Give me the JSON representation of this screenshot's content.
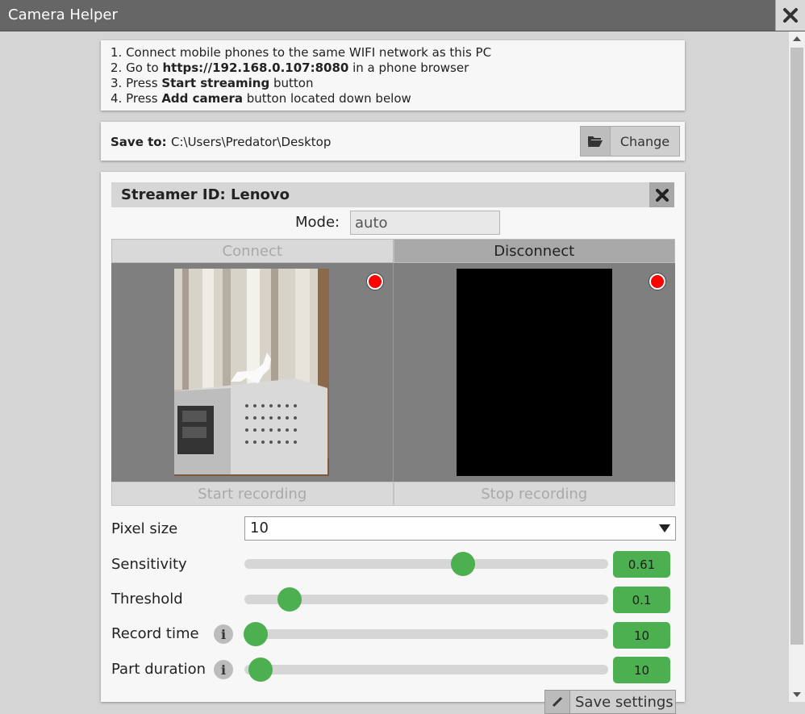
{
  "app": {
    "title": "Camera Helper"
  },
  "instructions": {
    "lines": [
      {
        "prefix": "1. Connect mobile phones to the same WIFI network as this PC",
        "bold": "",
        "suffix": ""
      },
      {
        "prefix": "2. Go to ",
        "bold": "https://192.168.0.107:8080",
        "suffix": " in a phone browser"
      },
      {
        "prefix": "3. Press ",
        "bold": "Start streaming",
        "suffix": " button"
      },
      {
        "prefix": "4. Press ",
        "bold": "Add camera",
        "suffix": " button located down below"
      }
    ]
  },
  "save_to": {
    "label": "Save to:",
    "path": "C:\\Users\\Predator\\Desktop",
    "change_label": "Change",
    "icon": "folder-open-icon"
  },
  "streamer": {
    "title": "Streamer ID: Lenovo",
    "mode_label": "Mode:",
    "mode_value": "auto",
    "connect_label": "Connect",
    "disconnect_label": "Disconnect",
    "start_recording_label": "Start recording",
    "stop_recording_label": "Stop recording",
    "record_dot_color": "#ff0000"
  },
  "settings": {
    "pixel_size": {
      "label": "Pixel size",
      "value": "10"
    },
    "sensitivity": {
      "label": "Sensitivity",
      "value": "0.61",
      "fraction": 0.6
    },
    "threshold": {
      "label": "Threshold",
      "value": "0.1",
      "fraction": 0.125
    },
    "record_time": {
      "label": "Record time",
      "value": "10",
      "fraction": 0.03
    },
    "part_duration": {
      "label": "Part duration",
      "value": "10",
      "fraction": 0.045
    },
    "save_settings_label": "Save settings",
    "accent": "#4caf50"
  }
}
